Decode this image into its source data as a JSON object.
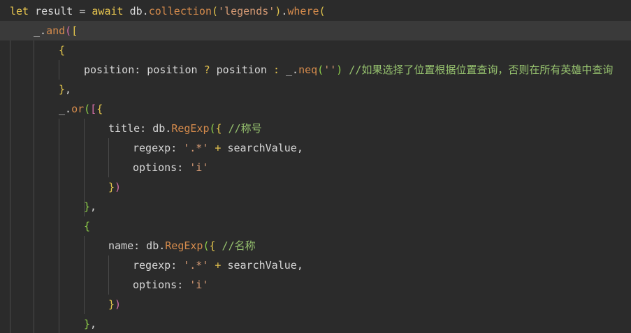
{
  "colors": {
    "background": "#2b2b2b",
    "active_line": "#3a3a3a",
    "default": "#d7d7d7",
    "keyword": "#e6c44f",
    "function": "#d0a47a",
    "string": "#d59a74",
    "comment": "#97c36f",
    "bracket_yellow": "#e1c44c",
    "bracket_green": "#8fd04a",
    "bracket_pink": "#d46ea8",
    "method_orange": "#d58b4c"
  },
  "code": {
    "lines": [
      [
        {
          "t": "let",
          "c": "keyword"
        },
        {
          "t": " result = ",
          "c": "default"
        },
        {
          "t": "await",
          "c": "keyword"
        },
        {
          "t": " db.",
          "c": "default"
        },
        {
          "t": "collection",
          "c": "method_orange"
        },
        {
          "t": "(",
          "c": "bracket_yellow"
        },
        {
          "t": "'legends'",
          "c": "string"
        },
        {
          "t": ")",
          "c": "bracket_yellow"
        },
        {
          "t": ".",
          "c": "default"
        },
        {
          "t": "where",
          "c": "method_orange"
        },
        {
          "t": "(",
          "c": "bracket_yellow"
        }
      ],
      [
        {
          "t": "_.",
          "c": "default"
        },
        {
          "t": "and",
          "c": "method_orange"
        },
        {
          "t": "(",
          "c": "bracket_pink"
        },
        {
          "t": "[",
          "c": "bracket_yellow"
        }
      ],
      [
        {
          "t": "{",
          "c": "bracket_yellow"
        }
      ],
      [
        {
          "t": "position",
          "c": "default"
        },
        {
          "t": ": position ",
          "c": "default"
        },
        {
          "t": "?",
          "c": "keyword"
        },
        {
          "t": " position ",
          "c": "default"
        },
        {
          "t": ":",
          "c": "keyword"
        },
        {
          "t": " _.",
          "c": "default"
        },
        {
          "t": "neq",
          "c": "method_orange"
        },
        {
          "t": "(",
          "c": "bracket_green"
        },
        {
          "t": "''",
          "c": "string"
        },
        {
          "t": ")",
          "c": "bracket_green"
        },
        {
          "t": " //如果选择了位置根据位置查询，否则在所有英雄中查询",
          "c": "comment"
        }
      ],
      [
        {
          "t": "}",
          "c": "bracket_yellow"
        },
        {
          "t": ",",
          "c": "default"
        }
      ],
      [
        {
          "t": "_.",
          "c": "default"
        },
        {
          "t": "or",
          "c": "method_orange"
        },
        {
          "t": "(",
          "c": "bracket_green"
        },
        {
          "t": "[",
          "c": "bracket_pink"
        },
        {
          "t": "{",
          "c": "bracket_yellow"
        }
      ],
      [
        {
          "t": "title",
          "c": "default"
        },
        {
          "t": ": db.",
          "c": "default"
        },
        {
          "t": "RegExp",
          "c": "method_orange"
        },
        {
          "t": "(",
          "c": "bracket_green"
        },
        {
          "t": "{",
          "c": "bracket_yellow"
        },
        {
          "t": " //称号",
          "c": "comment"
        }
      ],
      [
        {
          "t": "regexp",
          "c": "default"
        },
        {
          "t": ": ",
          "c": "default"
        },
        {
          "t": "'.*'",
          "c": "string"
        },
        {
          "t": " + ",
          "c": "keyword"
        },
        {
          "t": "searchValue",
          "c": "default"
        },
        {
          "t": ",",
          "c": "default"
        }
      ],
      [
        {
          "t": "options",
          "c": "default"
        },
        {
          "t": ": ",
          "c": "default"
        },
        {
          "t": "'i'",
          "c": "string"
        }
      ],
      [
        {
          "t": "}",
          "c": "bracket_yellow"
        },
        {
          "t": ")",
          "c": "bracket_pink"
        }
      ],
      [
        {
          "t": "}",
          "c": "bracket_green"
        },
        {
          "t": ",",
          "c": "default"
        }
      ],
      [
        {
          "t": "{",
          "c": "bracket_green"
        }
      ],
      [
        {
          "t": "name",
          "c": "default"
        },
        {
          "t": ": db.",
          "c": "default"
        },
        {
          "t": "RegExp",
          "c": "method_orange"
        },
        {
          "t": "(",
          "c": "bracket_green"
        },
        {
          "t": "{",
          "c": "bracket_yellow"
        },
        {
          "t": " //名称",
          "c": "comment"
        }
      ],
      [
        {
          "t": "regexp",
          "c": "default"
        },
        {
          "t": ": ",
          "c": "default"
        },
        {
          "t": "'.*'",
          "c": "string"
        },
        {
          "t": " + ",
          "c": "keyword"
        },
        {
          "t": "searchValue",
          "c": "default"
        },
        {
          "t": ",",
          "c": "default"
        }
      ],
      [
        {
          "t": "options",
          "c": "default"
        },
        {
          "t": ": ",
          "c": "default"
        },
        {
          "t": "'i'",
          "c": "string"
        }
      ],
      [
        {
          "t": "}",
          "c": "bracket_yellow"
        },
        {
          "t": ")",
          "c": "bracket_pink"
        }
      ],
      [
        {
          "t": "}",
          "c": "bracket_green"
        },
        {
          "t": ",",
          "c": "default"
        }
      ]
    ]
  }
}
